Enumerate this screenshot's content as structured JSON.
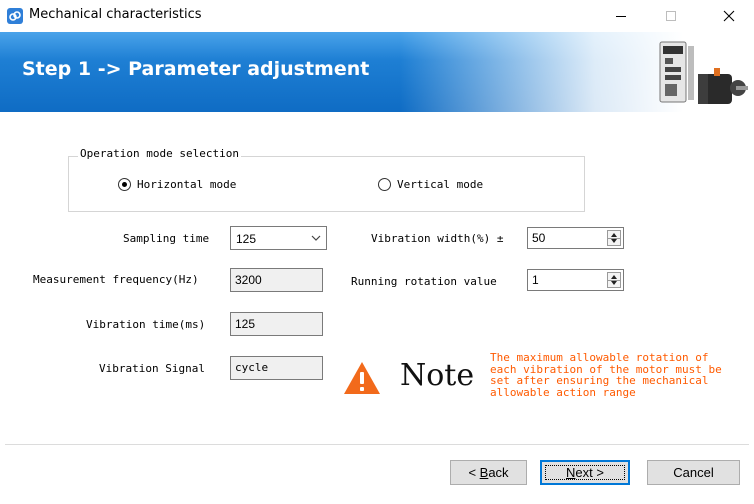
{
  "window": {
    "title": "Mechanical characteristics",
    "controls": {
      "minimize": "—",
      "maximize": "☐",
      "close": "✕"
    }
  },
  "banner": {
    "title": "Step 1 -> Parameter adjustment",
    "image_icon": "servo-drive-and-motor-icon"
  },
  "operation_mode": {
    "legend": "Operation mode selection",
    "options": [
      {
        "label": "Horizontal mode",
        "selected": true
      },
      {
        "label": "Vertical mode",
        "selected": false
      }
    ]
  },
  "fields": {
    "sampling_time": {
      "label": "Sampling time",
      "value": "125"
    },
    "measurement_frequency": {
      "label": "Measurement frequency(Hz)",
      "value": "3200"
    },
    "vibration_time": {
      "label": "Vibration time(ms)",
      "value": "125"
    },
    "vibration_signal": {
      "label": "Vibration Signal",
      "value": "cycle"
    },
    "vibration_width": {
      "label": "Vibration width(%) ±",
      "value": "50"
    },
    "running_rotation": {
      "label": "Running rotation value",
      "value": "1"
    }
  },
  "note": {
    "title": "Note",
    "icon": "warning-icon",
    "text": "The maximum allowable rotation of each vibration of the motor must be set after ensuring the mechanical allowable action range",
    "color": "#ff5a00"
  },
  "buttons": {
    "back": {
      "prefix": "< ",
      "mnemonic": "B",
      "rest": "ack"
    },
    "next": {
      "mnemonic": "N",
      "rest": "ext >"
    },
    "cancel": "Cancel"
  },
  "colors": {
    "banner": "#1e7fd4",
    "accent_focus": "#0078d7"
  }
}
